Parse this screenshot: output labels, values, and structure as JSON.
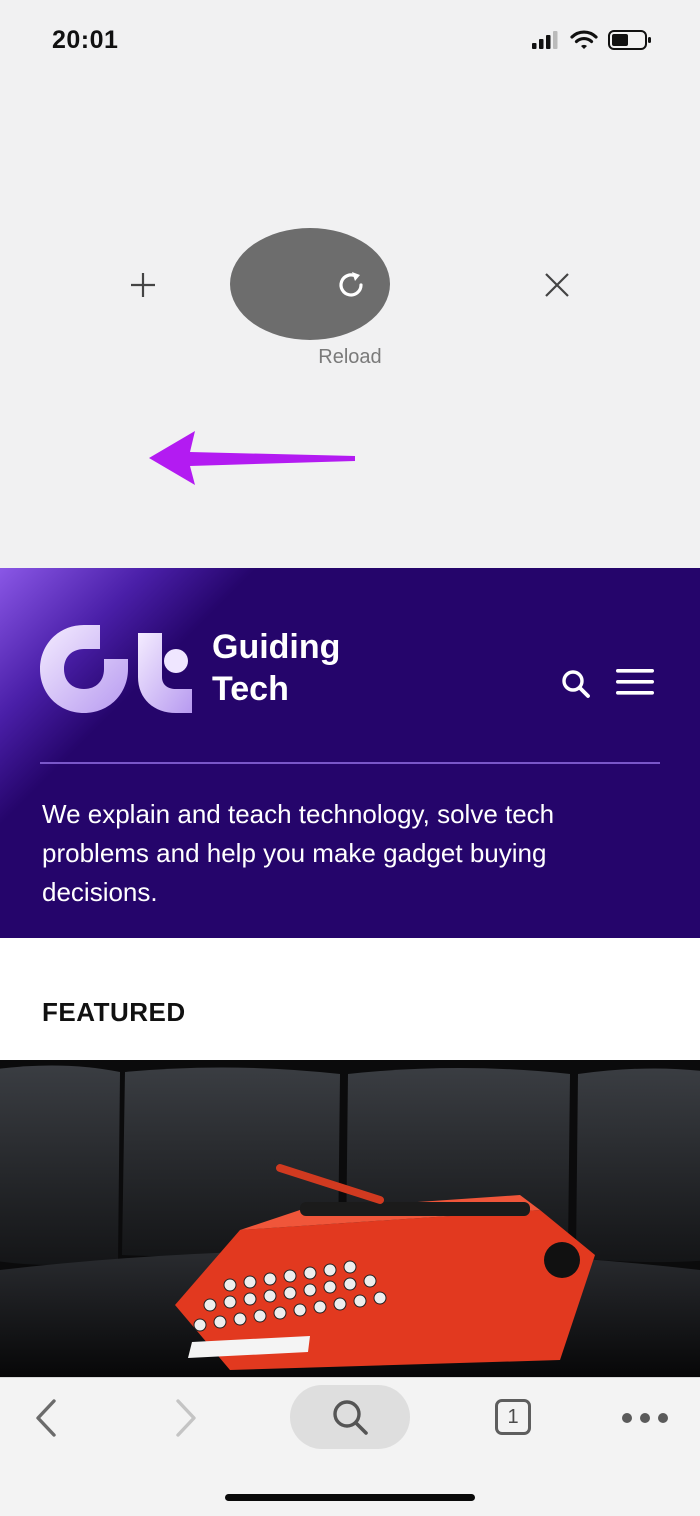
{
  "status_bar": {
    "time": "20:01"
  },
  "pull_actions": {
    "new_tab": "+",
    "reload_label": "Reload",
    "close": "×"
  },
  "site": {
    "brand_line1": "Guiding",
    "brand_line2": "Tech",
    "tagline": "We explain and teach technology, solve tech problems and help you make gadget buying decisions.",
    "featured_title": "FEATURED"
  },
  "toolbar": {
    "tab_count": "1"
  },
  "colors": {
    "header_bg": "#25056b",
    "accent_arrow": "#b31bf2"
  }
}
